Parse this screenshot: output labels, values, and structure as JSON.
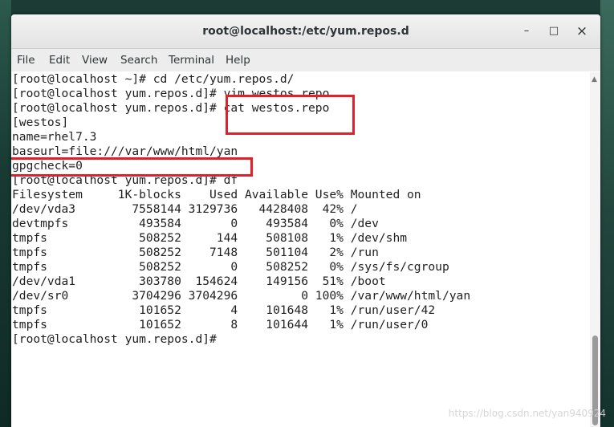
{
  "window": {
    "title": "root@localhost:/etc/yum.repos.d",
    "buttons": {
      "minimize": "–",
      "maximize": "□",
      "close": "×"
    }
  },
  "menu": [
    "File",
    "Edit",
    "View",
    "Search",
    "Terminal",
    "Help"
  ],
  "terminal": {
    "lines": [
      "[root@localhost ~]# cd /etc/yum.repos.d/",
      "[root@localhost yum.repos.d]# vim westos.repo",
      "[root@localhost yum.repos.d]# cat westos.repo",
      "[westos]",
      "name=rhel7.3",
      "baseurl=file:///var/www/html/yan",
      "gpgcheck=0",
      "[root@localhost yum.repos.d]# df",
      "Filesystem     1K-blocks    Used Available Use% Mounted on",
      "/dev/vda3        7558144 3129736   4428408  42% /",
      "devtmpfs          493584       0    493584   0% /dev",
      "tmpfs             508252     144    508108   1% /dev/shm",
      "tmpfs             508252    7148    501104   2% /run",
      "tmpfs             508252       0    508252   0% /sys/fs/cgroup",
      "/dev/vda1         303780  154624    149156  51% /boot",
      "/dev/sr0         3704296 3704296         0 100% /var/www/html/yan",
      "tmpfs             101652       4    101648   1% /run/user/42",
      "tmpfs             101652       8    101644   1% /run/user/0",
      "[root@localhost yum.repos.d]# "
    ]
  },
  "watermark": "https://blog.csdn.net/yan940924",
  "colors": {
    "highlight": "#e0202a",
    "text": "#1f1f1f"
  }
}
